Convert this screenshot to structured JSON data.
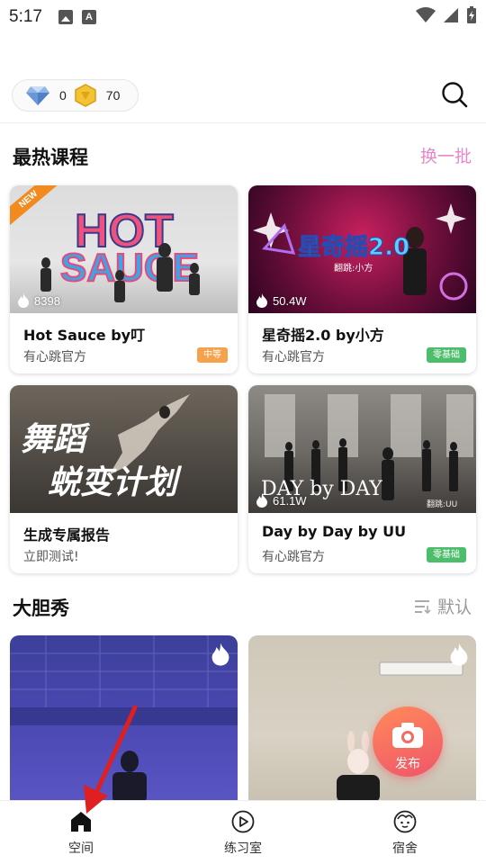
{
  "status_bar": {
    "time": "5:17"
  },
  "wallet": {
    "diamonds": "0",
    "coins": "70"
  },
  "hot_courses": {
    "title": "最热课程",
    "action": "换一批",
    "cards": [
      {
        "title": "Hot Sauce by叮",
        "subtitle": "有心跳官方",
        "views": "8398",
        "tag": "中等",
        "badge": "NEW",
        "thumb_text": "HOT SAUCE"
      },
      {
        "title": "星奇摇2.0 by小方",
        "subtitle": "有心跳官方",
        "views": "50.4W",
        "tag": "零基础",
        "thumb_text": "星奇摇2.0",
        "thumb_sub": "翻跳:小方"
      },
      {
        "title": "生成专属报告",
        "subtitle": "立即测试!",
        "thumb_text_1": "舞蹈",
        "thumb_text_2": "蜕变计划"
      },
      {
        "title": "Day by Day by UU",
        "subtitle": "有心跳官方",
        "views": "61.1W",
        "tag": "零基础",
        "thumb_text": "DAY by DAY",
        "thumb_sub": "翻跳:UU"
      }
    ]
  },
  "bold_show": {
    "title": "大胆秀",
    "sort_label": "默认"
  },
  "fab": {
    "label": "发布"
  },
  "bottom_nav": [
    {
      "label": "空间"
    },
    {
      "label": "练习室"
    },
    {
      "label": "宿舍"
    }
  ],
  "colors": {
    "accent_pink": "#e887c8",
    "tag_orange": "#f4a24c",
    "tag_green": "#4cbd6a",
    "fab": "#f0556a",
    "arrow_red": "#e02020"
  }
}
